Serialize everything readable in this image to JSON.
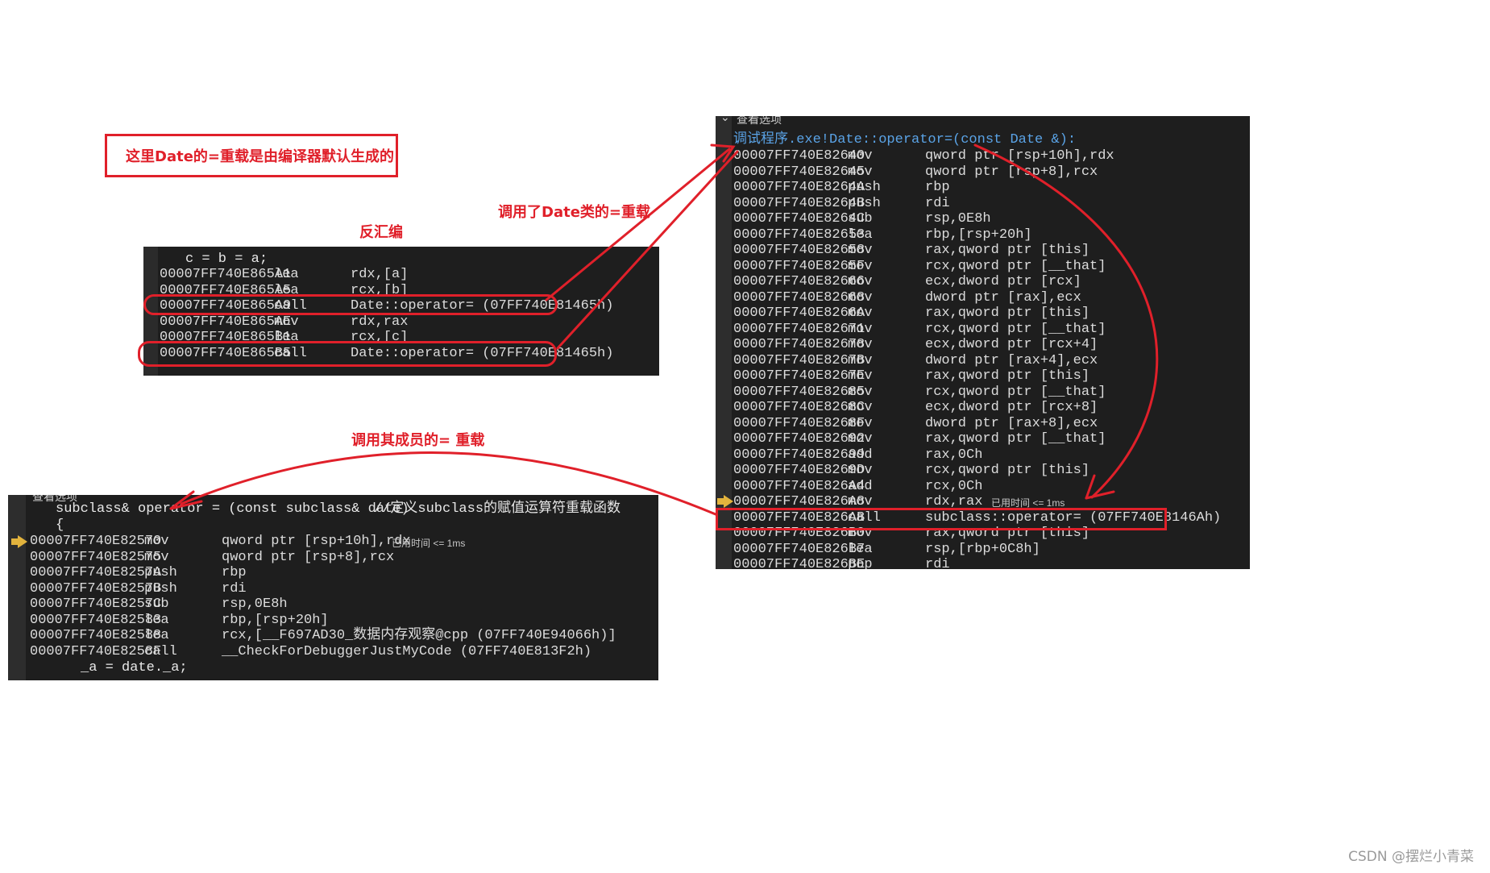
{
  "annotations": {
    "default_note": "这里Date的=重载是由编译器默认生成的",
    "disasm_label": "反汇编",
    "call_date_op": "调用了Date类的=重载",
    "call_member_op": "调用其成员的= 重载"
  },
  "top_panel": {
    "source_line": "c = b = a;",
    "rows": [
      {
        "addr": "00007FF740E865A1",
        "op": "lea",
        "args": "rdx,[a]"
      },
      {
        "addr": "00007FF740E865A5",
        "op": "lea",
        "args": "rcx,[b]"
      },
      {
        "addr": "00007FF740E865A9",
        "op": "call",
        "args": "Date::operator= (07FF740E81465h)"
      },
      {
        "addr": "00007FF740E865AE",
        "op": "mov",
        "args": "rdx,rax"
      },
      {
        "addr": "00007FF740E865B1",
        "op": "lea",
        "args": "rcx,[c]"
      },
      {
        "addr": "00007FF740E865B5",
        "op": "call",
        "args": "Date::operator= (07FF740E81465h)"
      }
    ]
  },
  "right_panel": {
    "view_options": "查看选项",
    "header": "调试程序.exe!Date::operator=(const Date &):",
    "timer": "已用时间 <= 1ms",
    "rows": [
      {
        "addr": "00007FF740E82640",
        "op": "mov",
        "args": "qword ptr [rsp+10h],rdx"
      },
      {
        "addr": "00007FF740E82645",
        "op": "mov",
        "args": "qword ptr [rsp+8],rcx"
      },
      {
        "addr": "00007FF740E8264A",
        "op": "push",
        "args": "rbp"
      },
      {
        "addr": "00007FF740E8264B",
        "op": "push",
        "args": "rdi"
      },
      {
        "addr": "00007FF740E8264C",
        "op": "sub",
        "args": "rsp,0E8h"
      },
      {
        "addr": "00007FF740E82653",
        "op": "lea",
        "args": "rbp,[rsp+20h]"
      },
      {
        "addr": "00007FF740E82658",
        "op": "mov",
        "args": "rax,qword ptr [this]"
      },
      {
        "addr": "00007FF740E8265F",
        "op": "mov",
        "args": "rcx,qword ptr [__that]"
      },
      {
        "addr": "00007FF740E82666",
        "op": "mov",
        "args": "ecx,dword ptr [rcx]"
      },
      {
        "addr": "00007FF740E82668",
        "op": "mov",
        "args": "dword ptr [rax],ecx"
      },
      {
        "addr": "00007FF740E8266A",
        "op": "mov",
        "args": "rax,qword ptr [this]"
      },
      {
        "addr": "00007FF740E82671",
        "op": "mov",
        "args": "rcx,qword ptr [__that]"
      },
      {
        "addr": "00007FF740E82678",
        "op": "mov",
        "args": "ecx,dword ptr [rcx+4]"
      },
      {
        "addr": "00007FF740E8267B",
        "op": "mov",
        "args": "dword ptr [rax+4],ecx"
      },
      {
        "addr": "00007FF740E8267E",
        "op": "mov",
        "args": "rax,qword ptr [this]"
      },
      {
        "addr": "00007FF740E82685",
        "op": "mov",
        "args": "rcx,qword ptr [__that]"
      },
      {
        "addr": "00007FF740E8268C",
        "op": "mov",
        "args": "ecx,dword ptr [rcx+8]"
      },
      {
        "addr": "00007FF740E8268F",
        "op": "mov",
        "args": "dword ptr [rax+8],ecx"
      },
      {
        "addr": "00007FF740E82692",
        "op": "mov",
        "args": "rax,qword ptr [__that]"
      },
      {
        "addr": "00007FF740E82699",
        "op": "add",
        "args": "rax,0Ch"
      },
      {
        "addr": "00007FF740E8269D",
        "op": "mov",
        "args": "rcx,qword ptr [this]"
      },
      {
        "addr": "00007FF740E826A4",
        "op": "add",
        "args": "rcx,0Ch"
      },
      {
        "addr": "00007FF740E826A8",
        "op": "mov",
        "args": "rdx,rax"
      },
      {
        "addr": "00007FF740E826AB",
        "op": "call",
        "args": "subclass::operator= (07FF740E8146Ah)"
      },
      {
        "addr": "00007FF740E826B0",
        "op": "mov",
        "args": "rax,qword ptr [this]"
      },
      {
        "addr": "00007FF740E826B7",
        "op": "lea",
        "args": "rsp,[rbp+0C8h]"
      },
      {
        "addr": "00007FF740E826BE",
        "op": "pop",
        "args": "rdi"
      }
    ]
  },
  "bottom_panel": {
    "view_options": "查看选项",
    "source_sig": "subclass& operator = (const subclass& date)",
    "source_comment": "//定义subclass的赋值运算符重载函数",
    "brace": "{",
    "timer": "已用时间 <= 1ms",
    "source_assign": "_a = date._a;",
    "rows": [
      {
        "addr": "00007FF740E82570",
        "op": "mov",
        "args": "qword ptr [rsp+10h],rdx"
      },
      {
        "addr": "00007FF740E82575",
        "op": "mov",
        "args": "qword ptr [rsp+8],rcx"
      },
      {
        "addr": "00007FF740E8257A",
        "op": "push",
        "args": "rbp"
      },
      {
        "addr": "00007FF740E8257B",
        "op": "push",
        "args": "rdi"
      },
      {
        "addr": "00007FF740E8257C",
        "op": "sub",
        "args": "rsp,0E8h"
      },
      {
        "addr": "00007FF740E82583",
        "op": "lea",
        "args": "rbp,[rsp+20h]"
      },
      {
        "addr": "00007FF740E82588",
        "op": "lea",
        "args": "rcx,[__F697AD30_数据内存观察@cpp (07FF740E94066h)]"
      },
      {
        "addr": "00007FF740E8258F",
        "op": "call",
        "args": "__CheckForDebuggerJustMyCode (07FF740E813F2h)"
      }
    ]
  },
  "watermark": "CSDN @摆烂小青菜"
}
